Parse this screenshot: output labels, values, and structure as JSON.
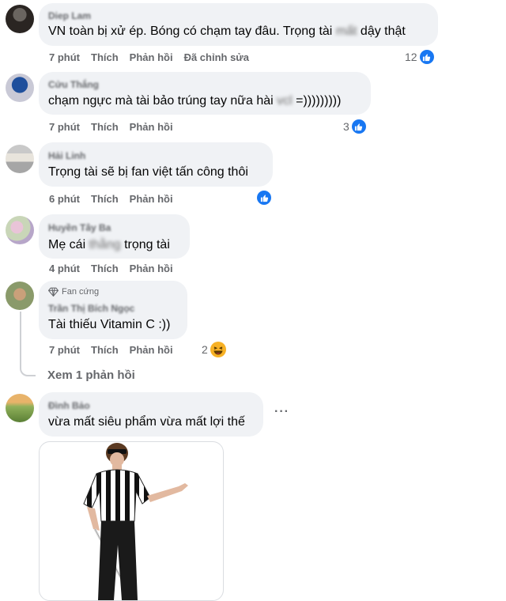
{
  "comments": [
    {
      "author": "Diep Lam",
      "text_before": "VN toàn bị xử ép. Bóng có chạm tay đâu. Trọng tài ",
      "text_blur": "mất",
      "text_after": " dậy thật",
      "time": "7 phút",
      "like": "Thích",
      "reply": "Phản hồi",
      "edited": "Đã chỉnh sửa",
      "reaction_count": "12"
    },
    {
      "author": "Cửu Thắng",
      "text_before": "chạm ngực mà tài bảo trúng tay nữa hài ",
      "text_blur": "vcl",
      "text_after": " =)))))))))",
      "time": "7 phút",
      "like": "Thích",
      "reply": "Phản hồi",
      "reaction_count": "3"
    },
    {
      "author": "Hải Linh",
      "text": "Trọng tài sẽ bị fan việt tấn công thôi",
      "time": "6 phút",
      "like": "Thích",
      "reply": "Phản hồi"
    },
    {
      "author": "Huyền Tây Ba",
      "text_before": "Mẹ",
      "text_mid": " cái ",
      "text_blur": "thằng",
      "text_after": " trọng tài",
      "time": "4 phút",
      "like": "Thích",
      "reply": "Phản hồi"
    },
    {
      "badge": "Fan cứng",
      "author": "Trần Thị Bích Ngọc",
      "text": "Tài thiếu Vitamin C :))",
      "time": "7 phút",
      "like": "Thích",
      "reply": "Phản hồi",
      "reaction_count": "2"
    },
    {
      "author": "Đình Bảo",
      "text": "vừa mất siêu phẩm vừa mất lợi thế",
      "more": "···"
    }
  ],
  "view_replies": "Xem 1 phản hồi",
  "icons": {
    "like": "thumbs-up-icon",
    "haha": "haha-icon",
    "badge": "diamond-icon",
    "more": "more-options-icon"
  },
  "colors": {
    "like_blue": "#1877f2",
    "haha_yellow": "#f7b125",
    "bubble": "#f0f2f5",
    "meta_gray": "#65676b"
  }
}
